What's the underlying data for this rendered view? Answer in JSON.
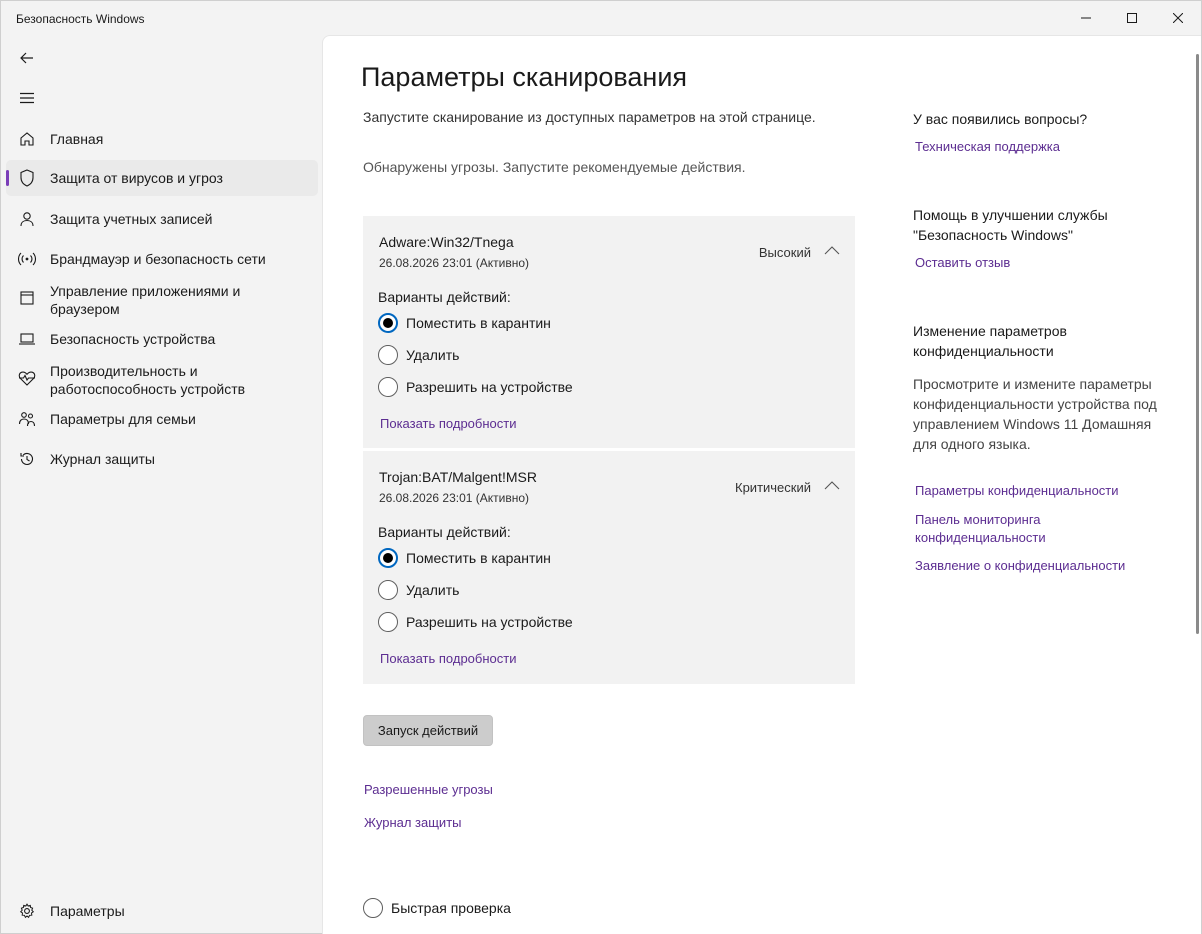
{
  "window": {
    "title": "Безопасность Windows"
  },
  "sidebar": {
    "items": [
      {
        "label": "Главная",
        "icon": "home-icon"
      },
      {
        "label": "Защита от вирусов и угроз",
        "icon": "shield-icon",
        "active": true
      },
      {
        "label": "Защита учетных записей",
        "icon": "person-icon"
      },
      {
        "label": "Брандмауэр и безопасность сети",
        "icon": "wifi-icon"
      },
      {
        "label": "Управление приложениями и браузером",
        "icon": "app-window-icon"
      },
      {
        "label": "Безопасность устройства",
        "icon": "laptop-icon"
      },
      {
        "label": "Производительность и работоспособность устройств",
        "icon": "heart-pulse-icon"
      },
      {
        "label": "Параметры для семьи",
        "icon": "family-icon"
      },
      {
        "label": "Журнал защиты",
        "icon": "history-icon"
      }
    ],
    "settings_label": "Параметры"
  },
  "main": {
    "title": "Параметры сканирования",
    "subtitle": "Запустите сканирование из доступных параметров на этой странице.",
    "threat_message": "Обнаружены угрозы. Запустите рекомендуемые действия.",
    "threats": [
      {
        "name": "Adware:Win32/Tnega",
        "date": "26.08.2026 23:01 (Активно)",
        "severity": "Высокий",
        "actions_label": "Варианты действий:",
        "options": [
          "Поместить в карантин",
          "Удалить",
          "Разрешить на устройстве"
        ],
        "selected": 0,
        "details_link": "Показать подробности"
      },
      {
        "name": "Trojan:BAT/Malgent!MSR",
        "date": "26.08.2026 23:01 (Активно)",
        "severity": "Критический",
        "actions_label": "Варианты действий:",
        "options": [
          "Поместить в карантин",
          "Удалить",
          "Разрешить на устройстве"
        ],
        "selected": 0,
        "details_link": "Показать подробности"
      }
    ],
    "run_button": "Запуск действий",
    "allowed_threats_link": "Разрешенные угрозы",
    "protection_history_link": "Журнал защиты",
    "quick_scan_label": "Быстрая проверка"
  },
  "right": {
    "questions_heading": "У вас появились вопросы?",
    "support_link": "Техническая поддержка",
    "improve_heading": "Помощь в улучшении службы \"Безопасность Windows\"",
    "feedback_link": "Оставить отзыв",
    "privacy_heading": "Изменение параметров конфиденциальности",
    "privacy_text": "Просмотрите и измените параметры конфиденциальности устройства под управлением Windows 11 Домашняя для одного языка.",
    "privacy_settings_link": "Параметры конфиденциальности",
    "privacy_dashboard_link": "Панель мониторинга конфиденциальности",
    "privacy_statement_link": "Заявление о конфиденциальности"
  },
  "colors": {
    "accent": "#7a3db8",
    "link": "#5c2d91",
    "radio_focus": "#0067c0"
  }
}
